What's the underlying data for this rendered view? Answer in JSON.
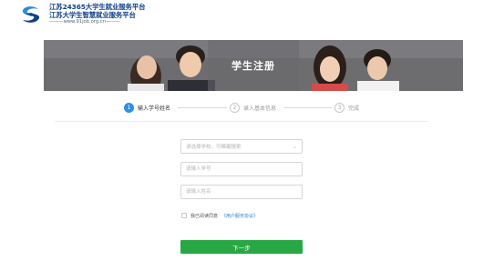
{
  "header": {
    "logo_line1": "江苏24365大学生就业服务平台",
    "logo_line2": "江苏大学生智慧就业服务平台",
    "logo_line3": "———www.91job.org.cn———",
    "brand_colors": {
      "primary": "#123f86",
      "accent": "#2e8bd8"
    }
  },
  "banner": {
    "title": "学生注册"
  },
  "steps": [
    {
      "number": "1",
      "label": "输入学号姓名",
      "active": true
    },
    {
      "number": "2",
      "label": "录入基本信息",
      "active": false
    },
    {
      "number": "3",
      "label": "完成",
      "active": false
    }
  ],
  "form": {
    "school_select": {
      "placeholder": "请选择学校，可模糊搜索",
      "icon": "chevron-down-icon"
    },
    "student_id": {
      "placeholder": "请输入学号",
      "value": ""
    },
    "name": {
      "placeholder": "请输入姓名",
      "value": ""
    },
    "agree": {
      "checked": false,
      "text": "我已阅读同意",
      "link": "《用户服务协议》"
    },
    "next_button": "下一步"
  },
  "colors": {
    "step_active": "#2f8ee6",
    "button_green": "#27a844",
    "link_blue": "#2f7fd8"
  }
}
